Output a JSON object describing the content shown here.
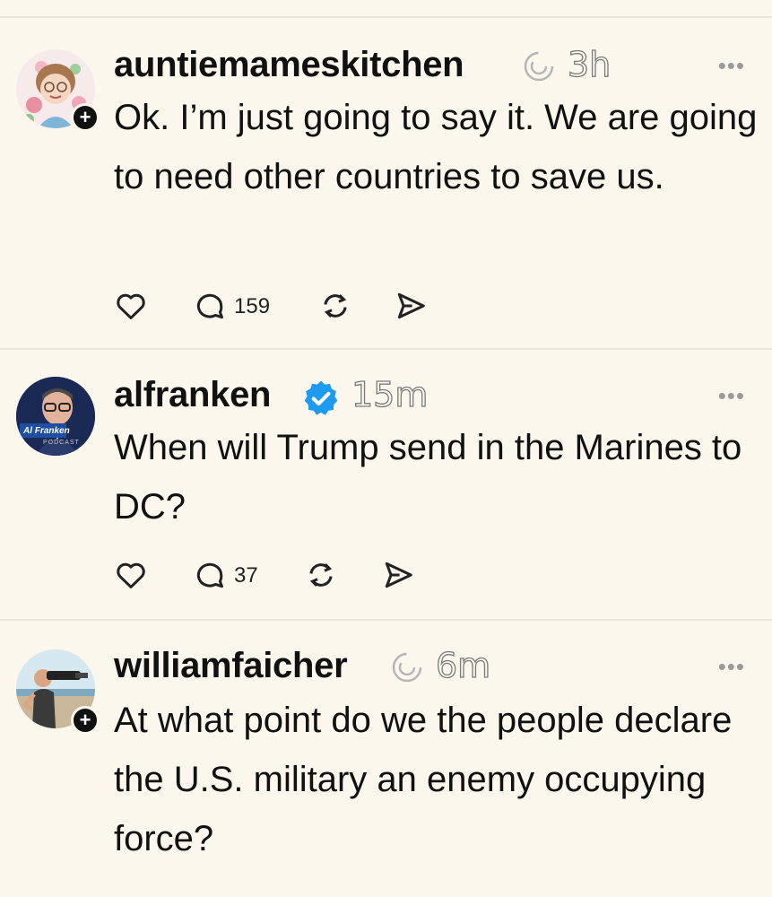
{
  "posts": [
    {
      "username": "auntiemameskitchen",
      "timestamp": "3h",
      "text": "Ok. I’m just going to say it. We are going to need other countries to save us.",
      "reply_count": "159",
      "more_label": "•••",
      "badge_icon": "thread-spiral-icon"
    },
    {
      "username": "alfranken",
      "timestamp": "15m",
      "text": "When will Trump send in the Marines to DC?",
      "reply_count": "37",
      "more_label": "•••",
      "badge_icon": "verified-check-icon",
      "avatar_caption": "Al Franken",
      "avatar_caption_small": "PODCAST"
    },
    {
      "username": "williamfaicher",
      "timestamp": "6m",
      "text": "At what point do we the people declare the U.S. military an enemy occupying force?",
      "more_label": "•••",
      "badge_icon": "thread-spiral-icon"
    }
  ],
  "colors": {
    "background": "#fcf7ec",
    "verified": "#1d9bf0",
    "text": "#111111",
    "muted": "#9a9a9a"
  }
}
